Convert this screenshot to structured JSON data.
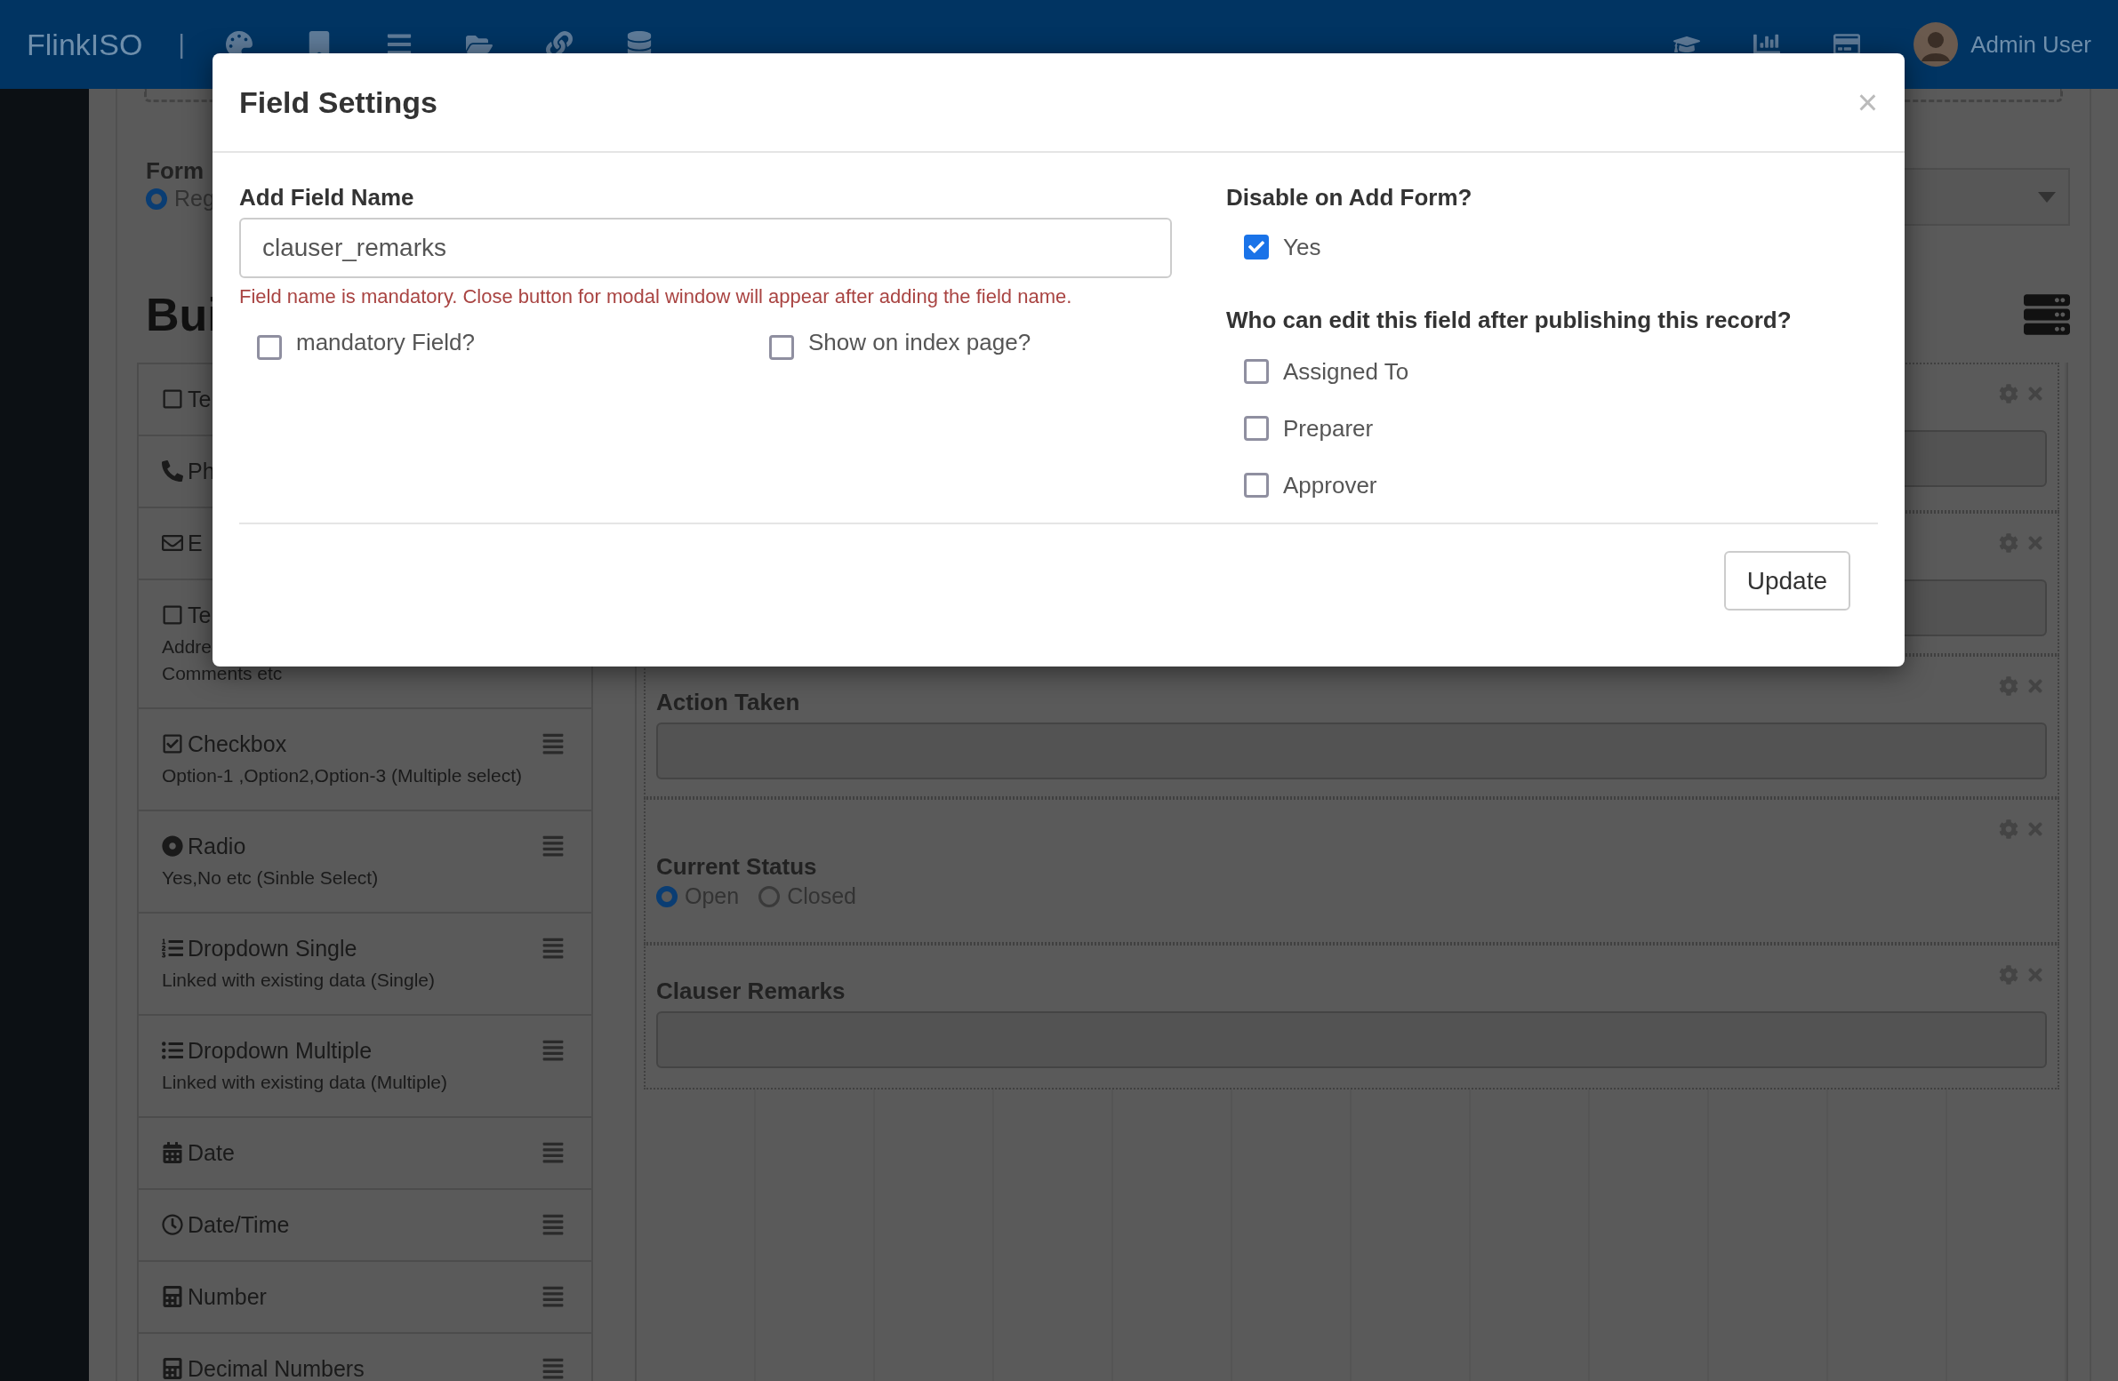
{
  "navbar": {
    "brand": "FlinkISO",
    "separator": "|",
    "user": {
      "name": "Admin User"
    }
  },
  "page": {
    "form_label": "Form",
    "form_type": {
      "label": "Reg",
      "selected": true
    },
    "heading": "Bui",
    "palette": [
      {
        "kind": "text",
        "title": "Te",
        "handle": false
      },
      {
        "kind": "phone",
        "title": "Ph",
        "handle": false
      },
      {
        "kind": "email",
        "title": "E",
        "handle": false
      },
      {
        "kind": "textarea",
        "title": "Te",
        "description_lines": [
          "Addre",
          "Comments etc"
        ],
        "handle": false
      },
      {
        "kind": "checkbox",
        "title": "Checkbox",
        "description_lines": [
          "Option-1 ,Option2,Option-3 (Multiple select)"
        ],
        "handle": true
      },
      {
        "kind": "radio",
        "title": "Radio",
        "description_lines": [
          "Yes,No etc (Sinble Select)"
        ],
        "handle": true
      },
      {
        "kind": "dropdown_single",
        "title": "Dropdown Single",
        "description_lines": [
          "Linked with existing data (Single)"
        ],
        "handle": true
      },
      {
        "kind": "dropdown_multiple",
        "title": "Dropdown Multiple",
        "description_lines": [
          "Linked with existing data (Multiple)"
        ],
        "handle": true
      },
      {
        "kind": "date",
        "title": "Date",
        "handle": true
      },
      {
        "kind": "datetime",
        "title": "Date/Time",
        "handle": true
      },
      {
        "kind": "number",
        "title": "Number",
        "handle": true
      },
      {
        "kind": "decimal",
        "title": "Decimal Numbers",
        "handle": true
      }
    ],
    "canvas_fields": [
      {
        "kind": "textarea"
      },
      {
        "kind": "textarea"
      },
      {
        "kind": "textarea",
        "label": "Action Taken"
      },
      {
        "kind": "radio",
        "label": "Current Status",
        "options": [
          {
            "label": "Open",
            "selected": true
          },
          {
            "label": "Closed",
            "selected": false
          }
        ]
      },
      {
        "kind": "textarea",
        "label": "Clauser Remarks"
      }
    ]
  },
  "modal": {
    "title": "Field Settings",
    "close": "×",
    "field_name": {
      "label": "Add Field Name",
      "value": "clauser_remarks",
      "error": "Field name is mandatory. Close button for modal window will appear after adding the field name."
    },
    "options": [
      {
        "label": "mandatory Field?",
        "checked": false
      },
      {
        "label": "Show on index page?",
        "checked": false
      }
    ],
    "disable_on_add": {
      "label": "Disable on Add Form?",
      "option": {
        "label": "Yes",
        "checked": true
      }
    },
    "editors": {
      "label": "Who can edit this field after publishing this record?",
      "options": [
        {
          "label": "Assigned To",
          "checked": false
        },
        {
          "label": "Preparer",
          "checked": false
        },
        {
          "label": "Approver",
          "checked": false
        }
      ]
    },
    "buttons": [
      {
        "label": "Update"
      }
    ]
  }
}
